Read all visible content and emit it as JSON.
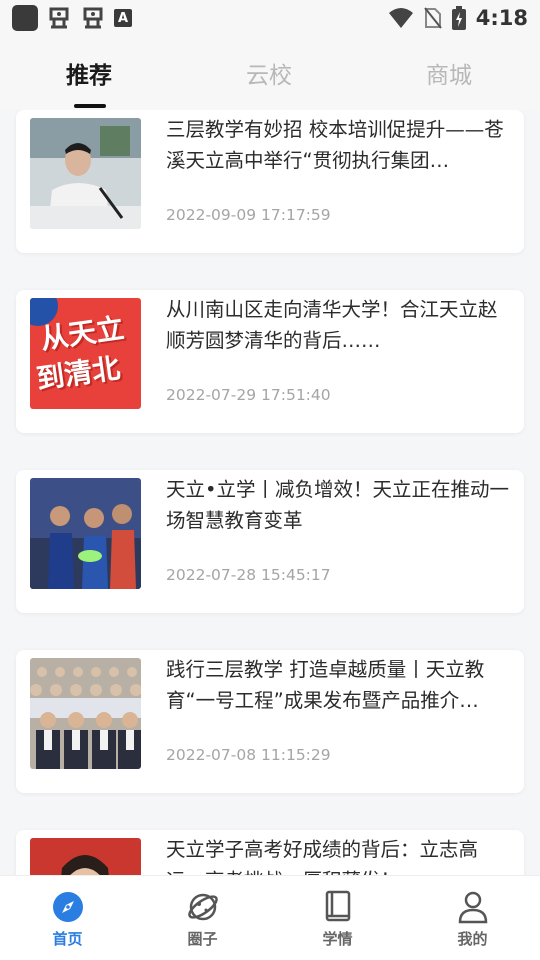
{
  "status_bar": {
    "time": "4:18",
    "notification_icons": [
      "app-icon",
      "bug-icon",
      "bug-icon",
      "a-box-icon"
    ],
    "system_icons": [
      "wifi-icon",
      "no-sim-icon",
      "battery-charging-icon"
    ]
  },
  "tabs": [
    {
      "label": "推荐",
      "active": true
    },
    {
      "label": "云校",
      "active": false
    },
    {
      "label": "商城",
      "active": false
    }
  ],
  "articles": [
    {
      "title": "三层教学有妙招  校本培训促提升——苍溪天立高中举行“贯彻执行集团…",
      "date": "2022-09-09 17:17:59",
      "thumb": "meeting-speaker-photo"
    },
    {
      "title": "从川南山区走向清华大学！合江天立赵顺芳圆梦清华的背后……",
      "date": "2022-07-29 17:51:40",
      "thumb": "poster",
      "thumb_text": [
        "从天立",
        "到清北"
      ]
    },
    {
      "title": "天立•立学丨减负增效！天立正在推动一场智慧教育变革",
      "date": "2022-07-28 15:45:17",
      "thumb": "classroom-students-photo"
    },
    {
      "title": "践行三层教学 打造卓越质量丨天立教育“一号工程”成果发布暨产品推介…",
      "date": "2022-07-08 11:15:29",
      "thumb": "conference-audience-photo"
    },
    {
      "title": "天立学子高考好成绩的背后：立志高远，高考挑战，厚积薄发！",
      "date": "",
      "thumb": "student-portrait-photo"
    }
  ],
  "bottom_nav": [
    {
      "label": "首页",
      "icon": "compass-icon",
      "active": true
    },
    {
      "label": "圈子",
      "icon": "planet-icon",
      "active": false
    },
    {
      "label": "学情",
      "icon": "book-icon",
      "active": false
    },
    {
      "label": "我的",
      "icon": "user-icon",
      "active": false
    }
  ],
  "colors": {
    "accent": "#2a7de1",
    "poster_red": "#e8403a"
  }
}
